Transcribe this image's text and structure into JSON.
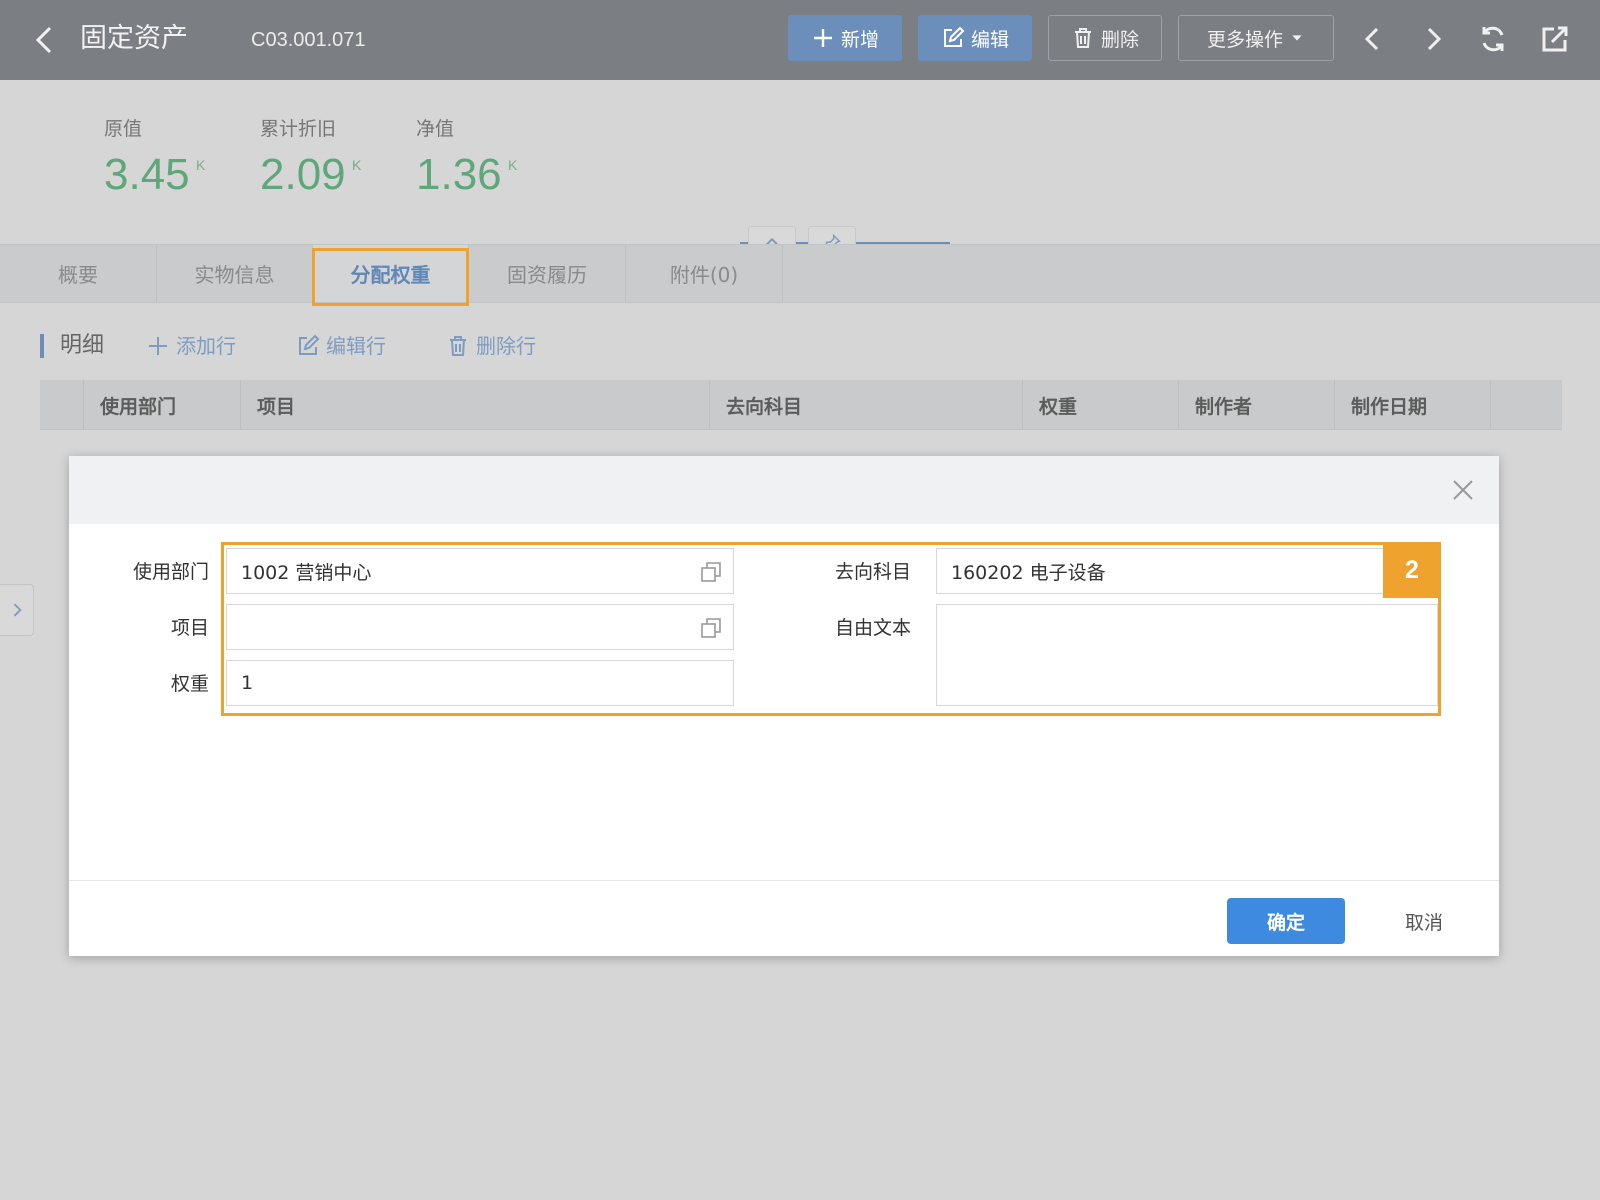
{
  "header": {
    "title": "固定资产",
    "code": "C03.001.071",
    "buttons": {
      "add": "新增",
      "edit": "编辑",
      "delete": "删除",
      "more": "更多操作"
    }
  },
  "summary": [
    {
      "label": "原值",
      "value": "3.45",
      "unit": "K"
    },
    {
      "label": "累计折旧",
      "value": "2.09",
      "unit": "K"
    },
    {
      "label": "净值",
      "value": "1.36",
      "unit": "K"
    }
  ],
  "tabs": [
    {
      "label": "概要"
    },
    {
      "label": "实物信息"
    },
    {
      "label": "分配权重"
    },
    {
      "label": "固资履历"
    },
    {
      "label": "附件(0)"
    }
  ],
  "detail": {
    "title": "明细",
    "tools": {
      "add_row": "添加行",
      "edit_row": "编辑行",
      "delete_row": "删除行"
    },
    "columns": [
      "使用部门",
      "项目",
      "去向科目",
      "权重",
      "制作者",
      "制作日期"
    ]
  },
  "modal": {
    "fields": {
      "department": {
        "label": "使用部门",
        "value": "1002 营销中心"
      },
      "project": {
        "label": "项目",
        "value": ""
      },
      "weight": {
        "label": "权重",
        "value": "1"
      },
      "target_account": {
        "label": "去向科目",
        "value": "160202 电子设备"
      },
      "free_text": {
        "label": "自由文本",
        "value": ""
      }
    },
    "step_badge": "2",
    "ok_label": "确定",
    "cancel_label": "取消"
  },
  "colors": {
    "header_bg": "#7b7e82",
    "primary": "#3d8ae0",
    "highlight": "#f0a22e",
    "stat_green": "#5fa77a"
  }
}
